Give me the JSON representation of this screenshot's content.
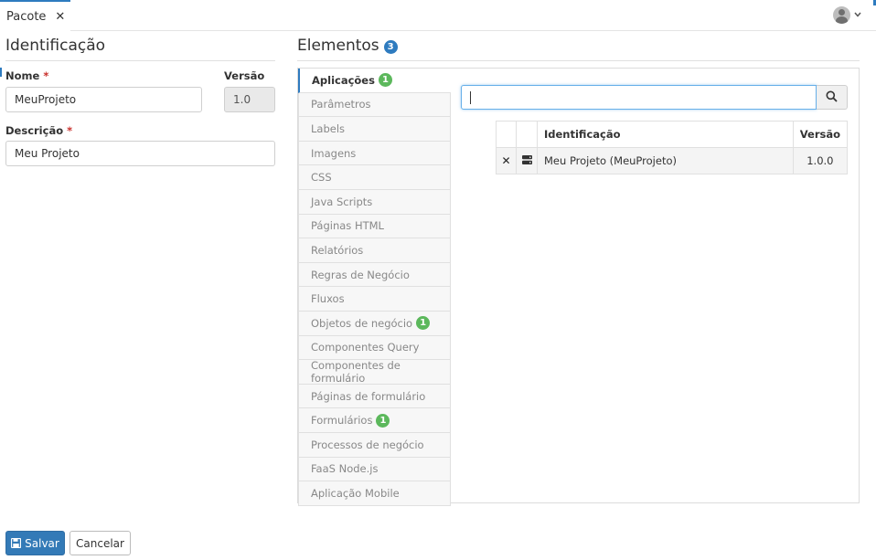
{
  "tab": {
    "title": "Pacote",
    "close_glyph": "✕"
  },
  "identification": {
    "title": "Identificação",
    "name_label": "Nome",
    "name_value": "MeuProjeto",
    "version_label": "Versão",
    "version_value": "1.0",
    "description_label": "Descrição",
    "description_value": "Meu Projeto",
    "required_mark": "*"
  },
  "elements": {
    "title": "Elementos",
    "count": "3",
    "tabs": [
      {
        "label": "Aplicações",
        "badge": "1"
      },
      {
        "label": "Parâmetros",
        "badge": ""
      },
      {
        "label": "Labels",
        "badge": ""
      },
      {
        "label": "Imagens",
        "badge": ""
      },
      {
        "label": "CSS",
        "badge": ""
      },
      {
        "label": "Java Scripts",
        "badge": ""
      },
      {
        "label": "Páginas HTML",
        "badge": ""
      },
      {
        "label": "Relatórios",
        "badge": ""
      },
      {
        "label": "Regras de Negócio",
        "badge": ""
      },
      {
        "label": "Fluxos",
        "badge": ""
      },
      {
        "label": "Objetos de negócio",
        "badge": "1"
      },
      {
        "label": "Componentes Query",
        "badge": ""
      },
      {
        "label": "Componentes de formulário",
        "badge": ""
      },
      {
        "label": "Páginas de formulário",
        "badge": ""
      },
      {
        "label": "Formulários",
        "badge": "1"
      },
      {
        "label": "Processos de negócio",
        "badge": ""
      },
      {
        "label": "FaaS Node.js",
        "badge": ""
      },
      {
        "label": "Aplicação Mobile",
        "badge": ""
      }
    ],
    "search": {
      "value": "",
      "icon": "search-icon"
    },
    "table": {
      "headers": [
        "",
        "",
        "Identificação",
        "Versão"
      ],
      "rows": [
        {
          "remove_glyph": "✕",
          "type_icon": "server-icon",
          "identification": "Meu Projeto (MeuProjeto)",
          "version": "1.0.0"
        }
      ]
    }
  },
  "actions": {
    "save_label": "Salvar",
    "cancel_label": "Cancelar"
  },
  "colors": {
    "primary": "#337ab7",
    "badge_blue": "#2e7bbf",
    "badge_green": "#5cb85c",
    "required": "#c9302c"
  }
}
